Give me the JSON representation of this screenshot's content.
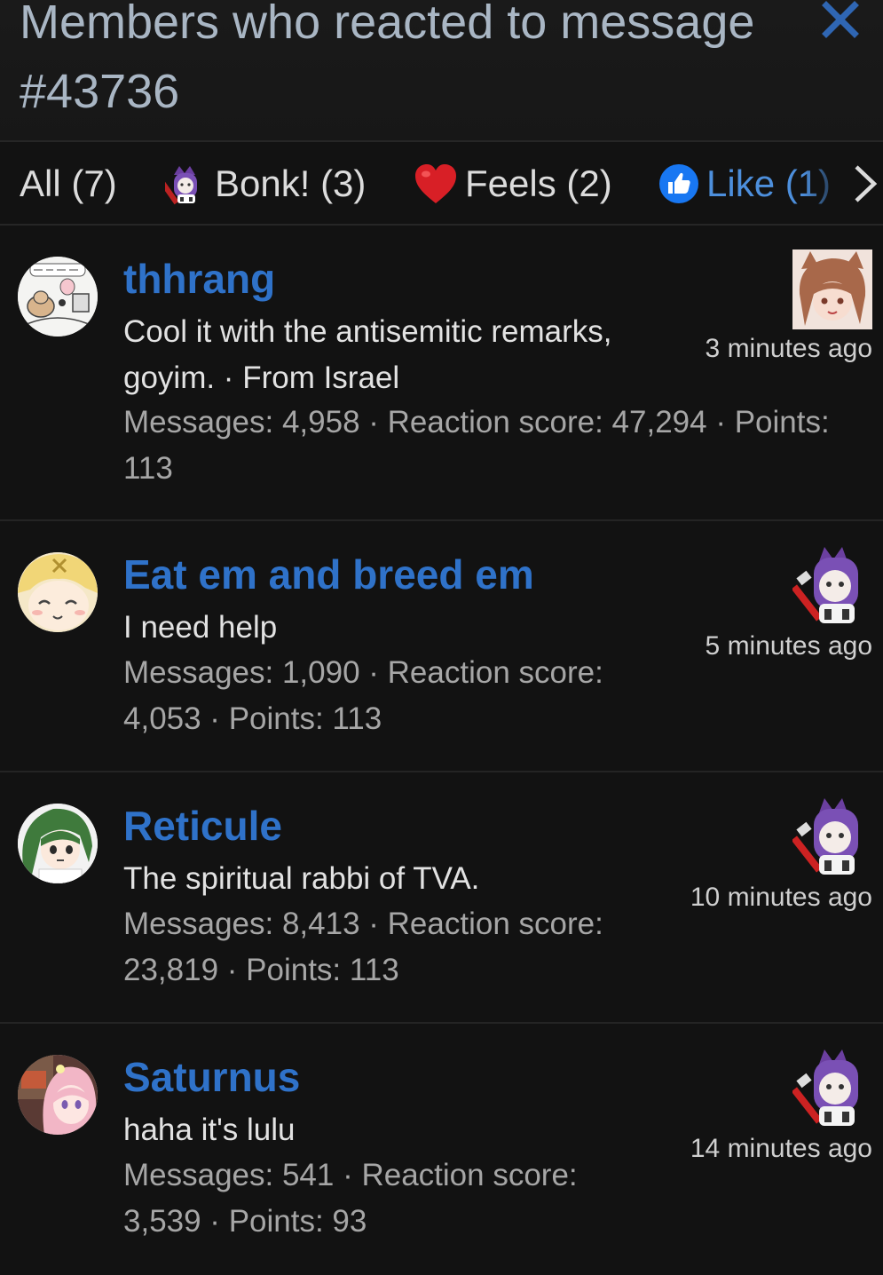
{
  "dialog": {
    "title": "Members who reacted to message #43736"
  },
  "tabs": [
    {
      "label": "All (7)",
      "icon": null
    },
    {
      "label": "Bonk! (3)",
      "icon": "bonk-reaction-icon"
    },
    {
      "label": "Feels (2)",
      "icon": "heart-icon"
    },
    {
      "label": "Like (1)",
      "icon": "thumbs-up-icon"
    }
  ],
  "members": [
    {
      "name": "thhrang",
      "title": "Cool it with the antisemitic remarks, goyim.",
      "location": "From Israel",
      "title_line": "Cool it with the antisemitic remarks, goyim. · From Israel",
      "stats": "Messages: 4,958 · Reaction score: 47,294 · Points: 113",
      "time": "3 minutes ago",
      "reaction": "brown-haired-girl-reaction-icon"
    },
    {
      "name": "Eat em and breed em",
      "title": "I need help",
      "title_line": "I need help",
      "stats": "Messages: 1,090 · Reaction score: 4,053 · Points: 113",
      "time": "5 minutes ago",
      "reaction": "bonk-reaction-icon"
    },
    {
      "name": "Reticule",
      "title": "The spiritual rabbi of TVA.",
      "title_line": "The spiritual rabbi of TVA.",
      "stats": "Messages: 8,413 · Reaction score: 23,819 · Points: 113",
      "time": "10 minutes ago",
      "reaction": "bonk-reaction-icon"
    },
    {
      "name": "Saturnus",
      "title": "haha it's lulu",
      "title_line": "haha it's lulu",
      "stats": "Messages: 541 · Reaction score: 3,539 · Points: 93",
      "time": "14 minutes ago",
      "reaction": "bonk-reaction-icon"
    }
  ],
  "colors": {
    "background": "#121212",
    "username": "#2f72c9",
    "title_text": "#a9b6c4",
    "close_icon": "#2f66b3",
    "like_tab": "#4d8fdc"
  }
}
